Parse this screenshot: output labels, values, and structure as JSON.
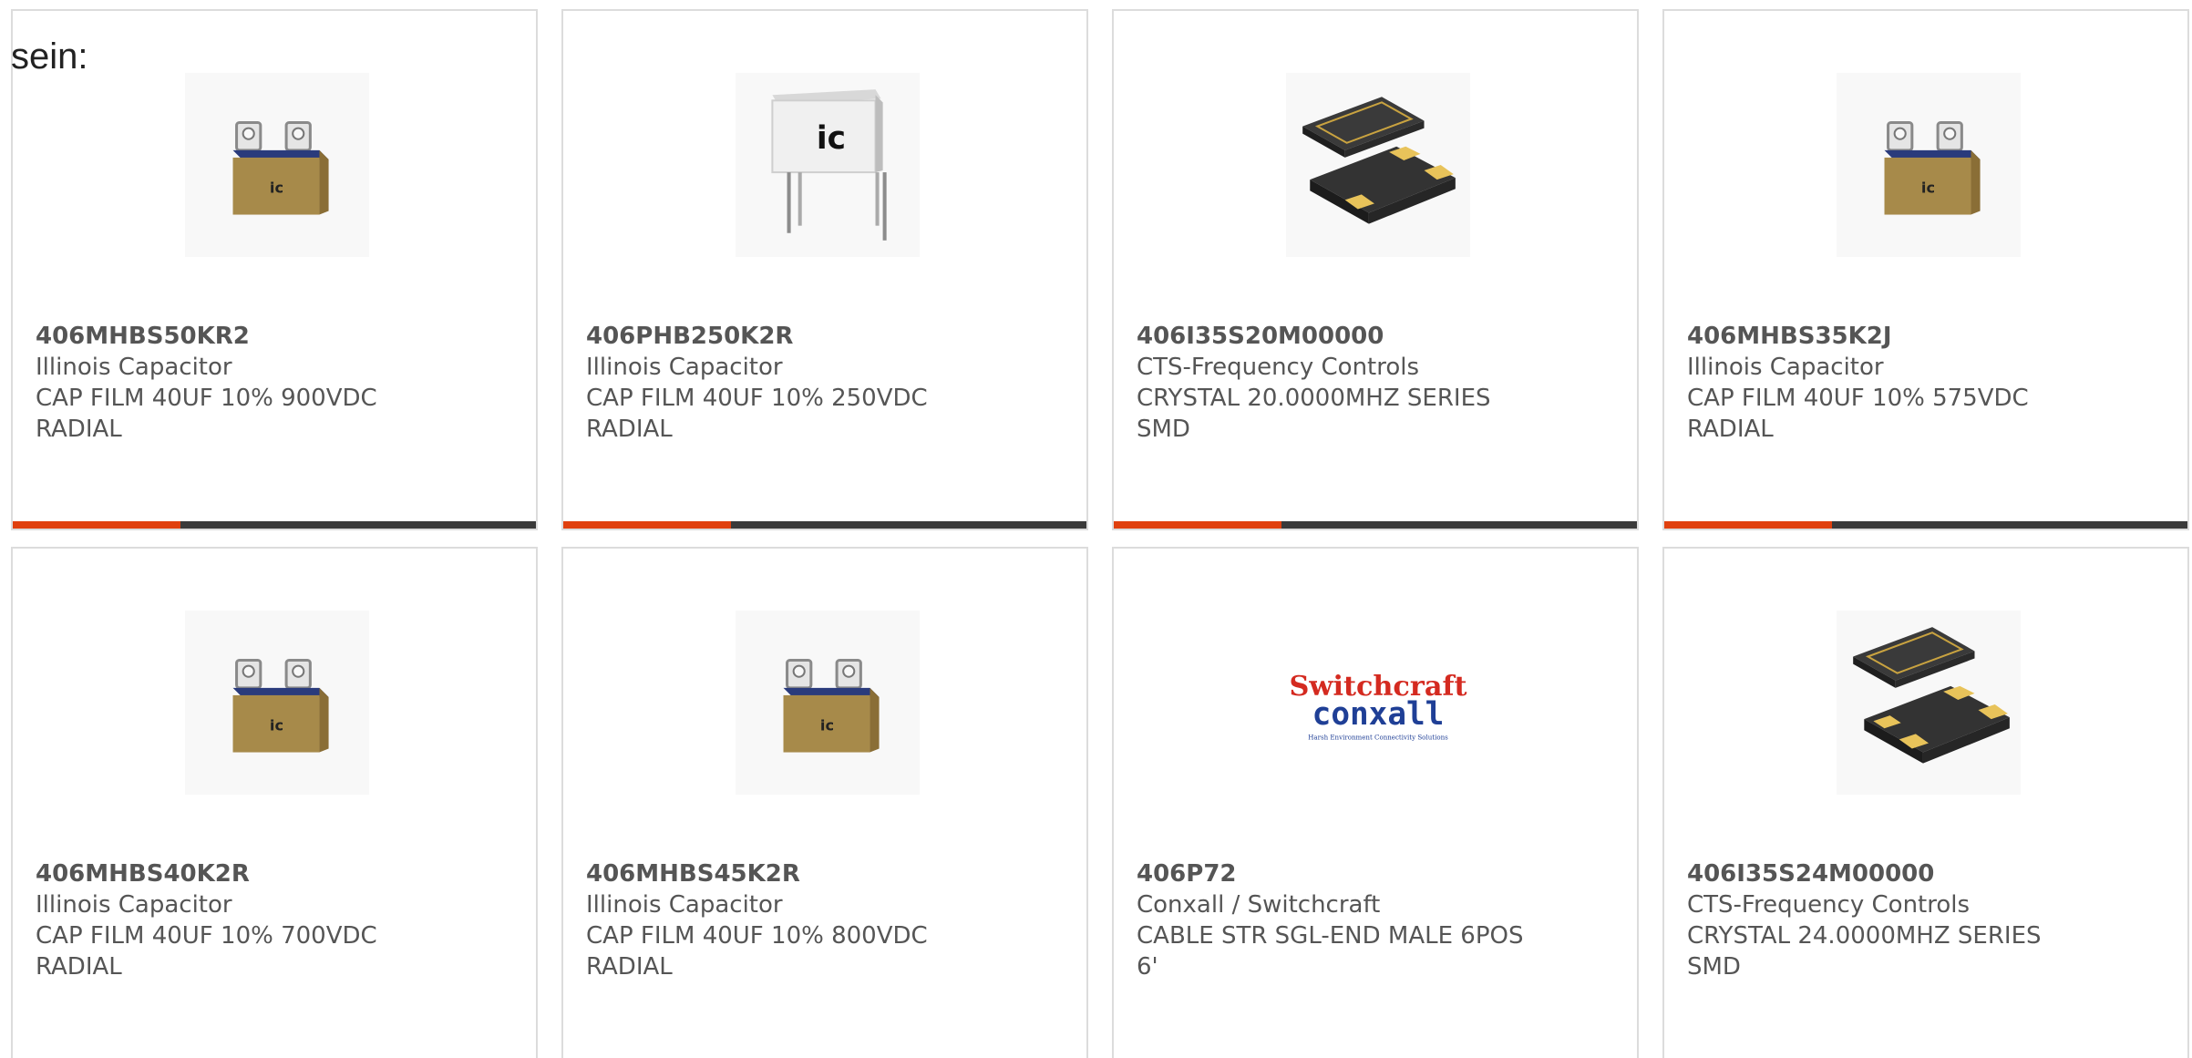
{
  "page": {
    "lead_text": "sein:"
  },
  "colors": {
    "accent": "#e0400e",
    "bar_track": "#3a3a3a",
    "text": "#555555",
    "border": "#dcdcdc"
  },
  "products": [
    {
      "part": "406MHBS50KR2",
      "maker": "Illinois Capacitor",
      "desc": "CAP FILM 40UF 10% 900VDC\nRADIAL",
      "image": "box-film-capacitor-icon",
      "progress_pct": 32
    },
    {
      "part": "406PHB250K2R",
      "maker": "Illinois Capacitor",
      "desc": "CAP FILM 40UF 10% 250VDC\nRADIAL",
      "image": "white-film-capacitor-icon",
      "progress_pct": 32
    },
    {
      "part": "406I35S20M00000",
      "maker": "CTS-Frequency Controls",
      "desc": "CRYSTAL 20.0000MHZ SERIES\nSMD",
      "image": "smd-crystal-icon",
      "progress_pct": 32
    },
    {
      "part": "406MHBS35K2J",
      "maker": "Illinois Capacitor",
      "desc": "CAP FILM 40UF 10% 575VDC\nRADIAL",
      "image": "box-film-capacitor-icon",
      "progress_pct": 32
    },
    {
      "part": "406MHBS40K2R",
      "maker": "Illinois Capacitor",
      "desc": "CAP FILM 40UF 10% 700VDC\nRADIAL",
      "image": "box-film-capacitor-icon"
    },
    {
      "part": "406MHBS45K2R",
      "maker": "Illinois Capacitor",
      "desc": "CAP FILM 40UF 10% 800VDC\nRADIAL",
      "image": "box-film-capacitor-icon"
    },
    {
      "part": "406P72",
      "maker": "Conxall / Switchcraft",
      "desc": "CABLE STR SGL-END MALE 6POS\n6'",
      "image": "switchcraft-conxall-logo",
      "logo": {
        "line1": "Switchcraft",
        "line2": "conxall",
        "tagline": "Harsh Environment Connectivity Solutions"
      }
    },
    {
      "part": "406I35S24M00000",
      "maker": "CTS-Frequency Controls",
      "desc": "CRYSTAL 24.0000MHZ SERIES\nSMD",
      "image": "smd-crystal-icon"
    }
  ]
}
